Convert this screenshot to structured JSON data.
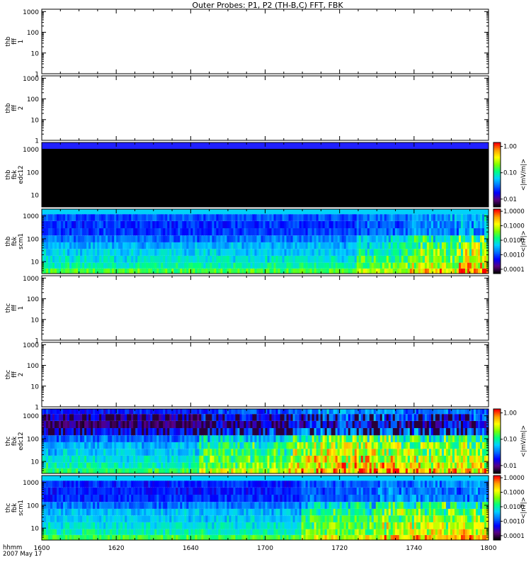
{
  "chart_data": {
    "type": "heatmap",
    "title": "Outer Probes: P1, P2 (TH-B,C) FFT, FBK",
    "x_axis": {
      "label_line1": "hhmm",
      "label_line2": "2007 May 17",
      "ticks": [
        "1600",
        "1620",
        "1640",
        "1700",
        "1720",
        "1740",
        "1800"
      ],
      "range": [
        "1600",
        "1800"
      ]
    },
    "panels": [
      {
        "id": "thb-fff-1",
        "ylabel": [
          "thb",
          "fff",
          "1"
        ],
        "y_scale": "log",
        "y_range": [
          1,
          1300
        ],
        "y_ticks": [
          "1000",
          "100",
          "10",
          "1"
        ],
        "content": "empty",
        "colorbar": null
      },
      {
        "id": "thb-fff-2",
        "ylabel": [
          "thb",
          "fff",
          "2"
        ],
        "y_scale": "log",
        "y_range": [
          1,
          1300
        ],
        "y_ticks": [
          "1000",
          "100",
          "10",
          "1"
        ],
        "content": "empty",
        "colorbar": null
      },
      {
        "id": "thb-fbk-edc12",
        "ylabel": [
          "thb",
          "fbk",
          "edc12"
        ],
        "y_scale": "log",
        "y_range": [
          3,
          2000
        ],
        "y_ticks": [
          "1000",
          "100",
          "10"
        ],
        "content": "spectrogram",
        "pattern": "black_uniform",
        "colorbar": {
          "label": "<|mV/m|>",
          "ticks": [
            "1.00",
            "0.10",
            "0.01"
          ],
          "log_range": [
            -2.3,
            0.15
          ]
        }
      },
      {
        "id": "thb-fbk-scm1",
        "ylabel": [
          "thb",
          "fbk",
          "scm1"
        ],
        "y_scale": "log",
        "y_range": [
          3,
          2000
        ],
        "y_ticks": [
          "1000",
          "100",
          "10"
        ],
        "content": "spectrogram",
        "pattern": "quiet_scm_b",
        "colorbar": {
          "label": "<|nT|>",
          "ticks": [
            "1.0000",
            "0.1000",
            "0.0100",
            "0.0010",
            "0.0001"
          ],
          "log_range": [
            -4.3,
            0.15
          ]
        }
      },
      {
        "id": "thc-fff-1",
        "ylabel": [
          "thc",
          "fff",
          "1"
        ],
        "y_scale": "log",
        "y_range": [
          1,
          1300
        ],
        "y_ticks": [
          "1000",
          "100",
          "10",
          "1"
        ],
        "content": "empty",
        "colorbar": null
      },
      {
        "id": "thc-fff-2",
        "ylabel": [
          "thc",
          "fff",
          "2"
        ],
        "y_scale": "log",
        "y_range": [
          1,
          1300
        ],
        "y_ticks": [
          "1000",
          "100",
          "10",
          "1"
        ],
        "content": "empty",
        "colorbar": null
      },
      {
        "id": "thc-fbk-edc12",
        "ylabel": [
          "thc",
          "fbk",
          "edc12"
        ],
        "y_scale": "log",
        "y_range": [
          3,
          2000
        ],
        "y_ticks": [
          "1000",
          "100",
          "10"
        ],
        "content": "spectrogram",
        "pattern": "active_edc_c",
        "colorbar": {
          "label": "<|mV/m|>",
          "ticks": [
            "1.00",
            "0.10",
            "0.01"
          ],
          "log_range": [
            -2.3,
            0.15
          ]
        }
      },
      {
        "id": "thc-fbk-scm1",
        "ylabel": [
          "thc",
          "fbk",
          "scm1"
        ],
        "y_scale": "log",
        "y_range": [
          3,
          2000
        ],
        "y_ticks": [
          "1000",
          "100",
          "10"
        ],
        "content": "spectrogram",
        "pattern": "active_scm_c",
        "colorbar": {
          "label": "<|nT|>",
          "ticks": [
            "1.0000",
            "0.1000",
            "0.0100",
            "0.0010",
            "0.0001"
          ],
          "log_range": [
            -4.3,
            0.15
          ]
        }
      }
    ],
    "colormap": [
      "#000000",
      "#5a0080",
      "#0000ff",
      "#0070ff",
      "#00d0ff",
      "#00ff80",
      "#80ff00",
      "#ffff00",
      "#ffa000",
      "#ff0000"
    ]
  }
}
